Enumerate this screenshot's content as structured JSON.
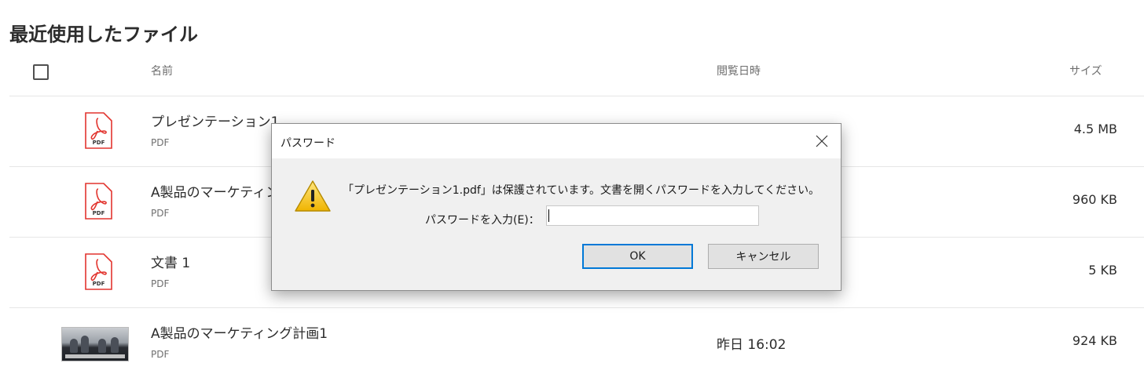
{
  "section": {
    "title": "最近使用したファイル"
  },
  "columns": {
    "name": "名前",
    "viewed": "閲覧日時",
    "size": "サイズ"
  },
  "files": [
    {
      "name": "プレゼンテーション1",
      "type": "PDF",
      "viewed": "",
      "size": "4.5 MB",
      "icon": "pdf-icon"
    },
    {
      "name": "A製品のマーケティン",
      "type": "PDF",
      "viewed": "",
      "size": "960 KB",
      "icon": "pdf-icon"
    },
    {
      "name": "文書 1",
      "type": "PDF",
      "viewed": "",
      "size": "5 KB",
      "icon": "pdf-icon"
    },
    {
      "name": "A製品のマーケティング計画1",
      "type": "PDF",
      "viewed": "昨日 16:02",
      "size": "924 KB",
      "icon": "thumbnail"
    }
  ],
  "pdf_icon_label": "PDF",
  "dialog": {
    "title": "パスワード",
    "message": "「プレゼンテーション1.pdf」は保護されています。文書を開くパスワードを入力してください。",
    "password_label": "パスワードを入力(E)：",
    "password_value": "",
    "ok_label": "OK",
    "cancel_label": "キャンセル"
  },
  "colors": {
    "pdf_red": "#e2342e",
    "ok_border": "#0078d7",
    "warning_yellow": "#f4c51b"
  }
}
